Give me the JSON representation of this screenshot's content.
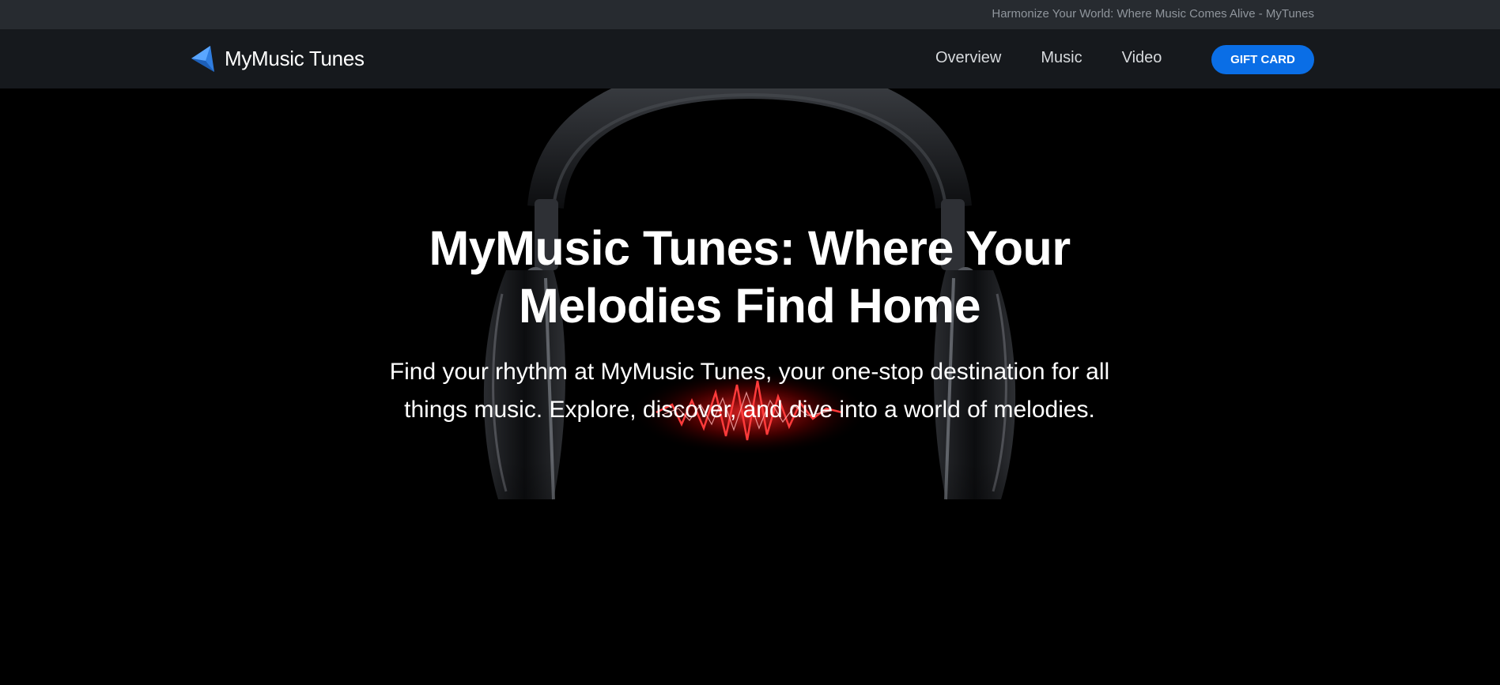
{
  "topbar": {
    "tagline": "Harmonize Your World: Where Music Comes Alive - MyTunes"
  },
  "brand": {
    "name": "MyMusic Tunes",
    "icon": "play-triangle-logo",
    "accent_color": "#3d8ef5"
  },
  "nav": {
    "items": [
      {
        "label": "Overview"
      },
      {
        "label": "Music"
      },
      {
        "label": "Video"
      }
    ],
    "cta_label": "GIFT CARD",
    "cta_color": "#0a6ee6"
  },
  "hero": {
    "title": "MyMusic Tunes: Where Your Melodies Find Home",
    "subtitle": "Find your rhythm at MyMusic Tunes, your one-stop destination for all things music. Explore, discover, and dive into a world of melodies.",
    "background_image": "headphones-with-red-soundwave"
  }
}
